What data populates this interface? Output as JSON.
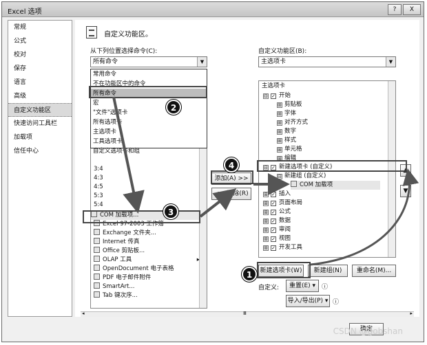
{
  "window": {
    "title": "Excel 选项",
    "help": "?",
    "close": "X"
  },
  "nav": {
    "items": [
      "常规",
      "公式",
      "校对",
      "保存",
      "语言",
      "高级",
      "自定义功能区",
      "快速访问工具栏",
      "加载项",
      "信任中心"
    ]
  },
  "header": {
    "title": "自定义功能区。"
  },
  "left": {
    "label": "从下列位置选择命令(C):",
    "combo_value": "所有命令",
    "dropdown_items": [
      "常用命令",
      "不在功能区中的命令",
      "所有命令",
      "宏",
      "\"文件\"选项卡",
      "所有选项卡",
      "主选项卡",
      "工具选项卡",
      "自定义选项卡和组"
    ],
    "list_items": [
      "3:4",
      "4:3",
      "4:5",
      "5:3",
      "5:4",
      "COM 加载项...",
      "Excel 97-2003 工作簿",
      "Exchange 文件夹...",
      "Internet 传真",
      "Office 剪贴板...",
      "OLAP 工具",
      "OpenDocument 电子表格",
      "PDF 电子邮件附件",
      "SmartArt...",
      "Tab 键次序..."
    ],
    "olap_arrow": "▸"
  },
  "middle": {
    "add_label": "添加(A) >>",
    "remove_label": "<< 删除(R)"
  },
  "right": {
    "label": "自定义功能区(B):",
    "combo_value": "主选项卡",
    "tree_header": "主选项卡",
    "tree": [
      {
        "text": "开始",
        "indent": 0,
        "exp": "⊟",
        "cb": true
      },
      {
        "text": "剪贴板",
        "indent": 1,
        "exp": "⊞",
        "cb": false
      },
      {
        "text": "字体",
        "indent": 1,
        "exp": "⊞",
        "cb": false
      },
      {
        "text": "对齐方式",
        "indent": 1,
        "exp": "⊞",
        "cb": false
      },
      {
        "text": "数字",
        "indent": 1,
        "exp": "⊞",
        "cb": false
      },
      {
        "text": "样式",
        "indent": 1,
        "exp": "⊞",
        "cb": false
      },
      {
        "text": "单元格",
        "indent": 1,
        "exp": "⊞",
        "cb": false
      },
      {
        "text": "编辑",
        "indent": 1,
        "exp": "⊞",
        "cb": false
      },
      {
        "text": "新建选项卡 (自定义)",
        "indent": 0,
        "exp": "⊟",
        "cb": true
      },
      {
        "text": "新建组 (自定义)",
        "indent": 1,
        "exp": "⊟",
        "cb": false
      },
      {
        "text": "COM 加载项",
        "indent": 2,
        "exp": "",
        "cb": false
      },
      {
        "text": "插入",
        "indent": 0,
        "exp": "⊞",
        "cb": true
      },
      {
        "text": "页面布局",
        "indent": 0,
        "exp": "⊞",
        "cb": true
      },
      {
        "text": "公式",
        "indent": 0,
        "exp": "⊞",
        "cb": true
      },
      {
        "text": "数据",
        "indent": 0,
        "exp": "⊞",
        "cb": true
      },
      {
        "text": "审阅",
        "indent": 0,
        "exp": "⊞",
        "cb": true
      },
      {
        "text": "视图",
        "indent": 0,
        "exp": "⊞",
        "cb": true
      },
      {
        "text": "开发工具",
        "indent": 0,
        "exp": "⊞",
        "cb": true
      }
    ],
    "new_tab": "新建选项卡(W)",
    "new_group": "新建组(N)",
    "rename": "重命名(M)...",
    "custom_label": "自定义:",
    "reset": "重置(E) ▾",
    "import_export": "导入/导出(P) ▾",
    "info": "ⓘ",
    "up": "▲",
    "down": "▼"
  },
  "scroll": {
    "left": "◂",
    "right": "▸",
    "thumb": "Ⅲ"
  },
  "footer": {
    "ok": "确定",
    "watermark": "CSDN @gobshan"
  },
  "markers": [
    "1",
    "2",
    "3",
    "4"
  ],
  "colors": {
    "highlight": "#dadada",
    "marker": "#111111"
  }
}
